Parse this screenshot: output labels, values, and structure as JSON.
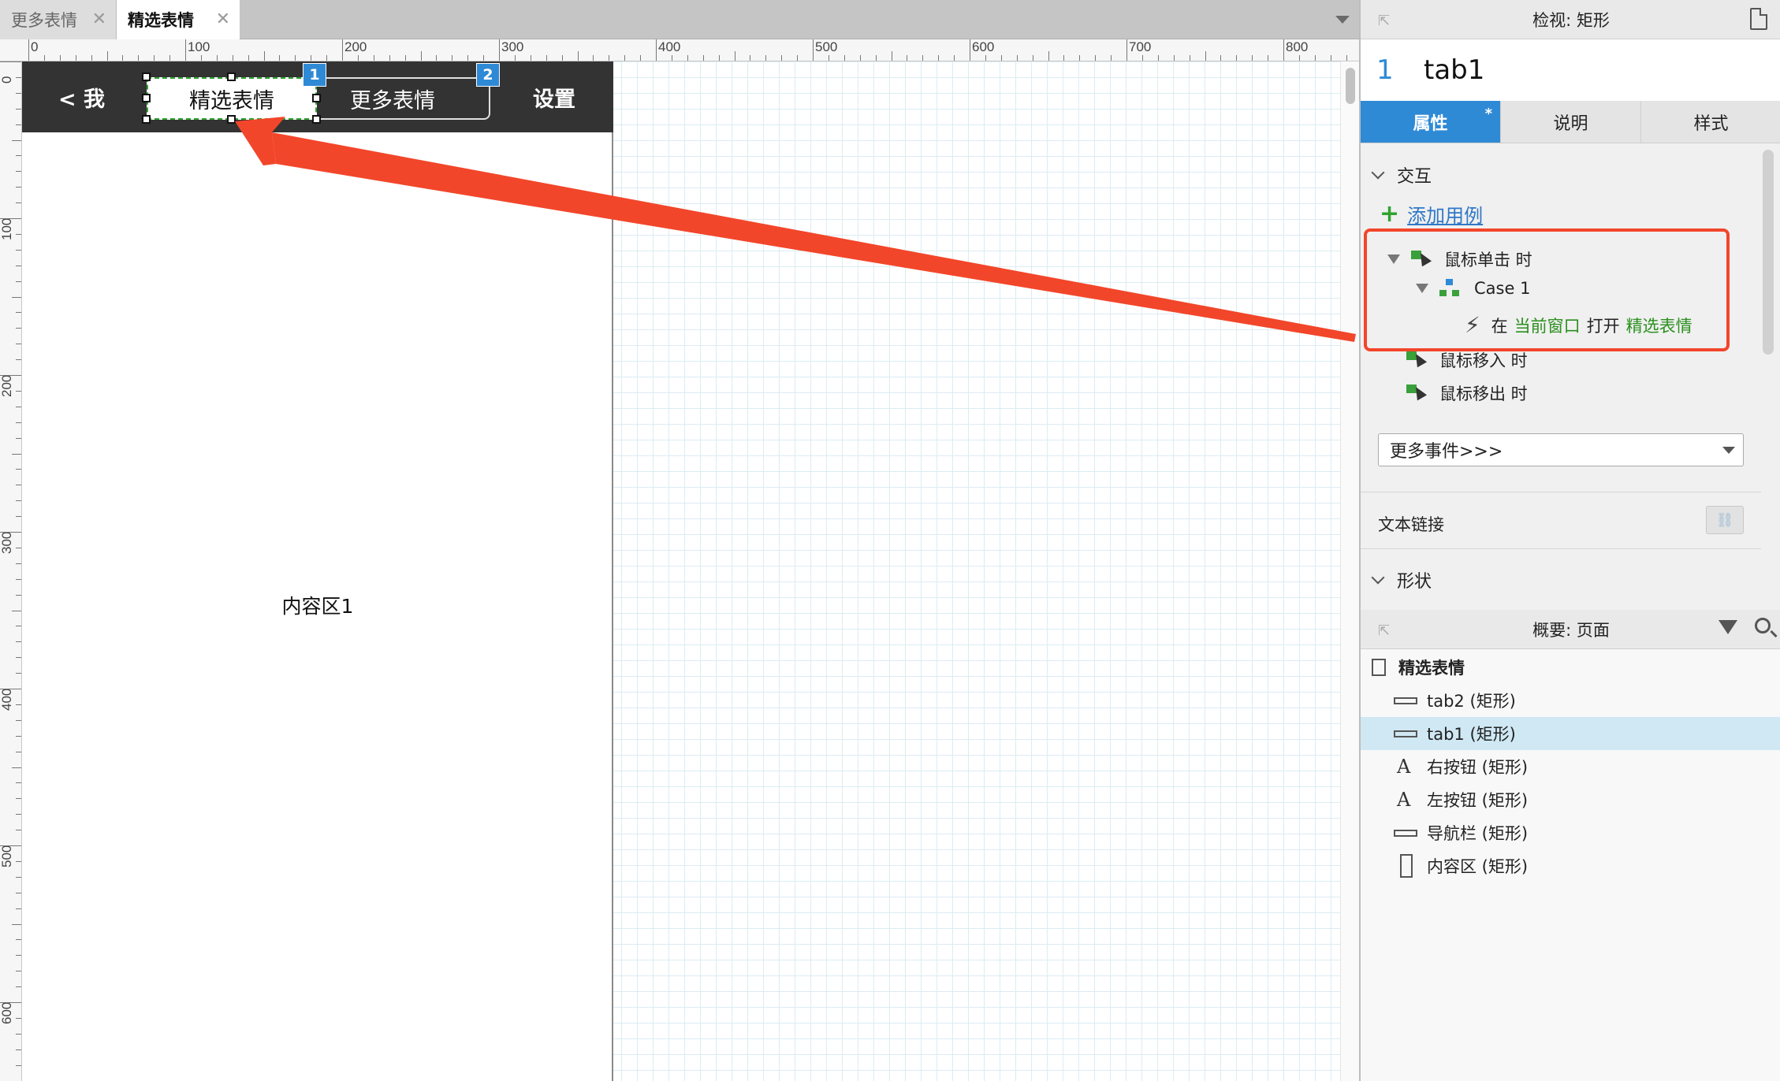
{
  "doc_tabs": [
    {
      "label": "更多表情",
      "close": "✕",
      "active": false
    },
    {
      "label": "精选表情",
      "close": "✕",
      "active": true
    }
  ],
  "ruler": {
    "horizontal": [
      "0",
      "100",
      "200",
      "300",
      "400",
      "500",
      "600",
      "700",
      "800"
    ],
    "vertical": [
      "0",
      "100",
      "200",
      "300",
      "400",
      "500",
      "600"
    ]
  },
  "canvas": {
    "nav": {
      "back": "< 我",
      "tab1": "精选表情",
      "tab2": "更多表情",
      "settings": "设置"
    },
    "badges": [
      "1",
      "2"
    ],
    "content_label": "内容区1"
  },
  "inspector": {
    "header": "检视: 矩形",
    "widget_index": "1",
    "widget_name": "tab1",
    "tabs": [
      {
        "label": "属性",
        "active": true,
        "modified": "*"
      },
      {
        "label": "说明",
        "active": false
      },
      {
        "label": "样式",
        "active": false
      }
    ],
    "interaction_heading": "交互",
    "add_case": "添加用例",
    "events": {
      "click": "鼠标单击 时",
      "case": "Case 1",
      "action_prefix": "在",
      "action_target": "当前窗口",
      "action_verb": "打开",
      "action_page": "精选表情",
      "mouse_enter": "鼠标移入 时",
      "mouse_leave": "鼠标移出 时"
    },
    "more_events": "更多事件>>>",
    "text_link": "文本链接",
    "shape_heading": "形状"
  },
  "outline": {
    "header": "概要: 页面",
    "page": "精选表情",
    "items": [
      {
        "label": "tab2 (矩形)",
        "icon": "rect-icon",
        "selected": false
      },
      {
        "label": "tab1 (矩形)",
        "icon": "rect-icon",
        "selected": true
      },
      {
        "label": "右按钮 (矩形)",
        "icon": "text-icon",
        "glyph": "A",
        "selected": false
      },
      {
        "label": "左按钮 (矩形)",
        "icon": "text-icon",
        "glyph": "A",
        "selected": false
      },
      {
        "label": "导航栏 (矩形)",
        "icon": "rect-icon",
        "selected": false
      },
      {
        "label": "内容区 (矩形)",
        "icon": "tall-rect-icon",
        "selected": false
      }
    ]
  },
  "colors": {
    "accent_blue": "#2f8ad6",
    "annotation_red": "#f2462a",
    "action_green": "#2a8f1e",
    "navbar_dark": "#333333"
  }
}
